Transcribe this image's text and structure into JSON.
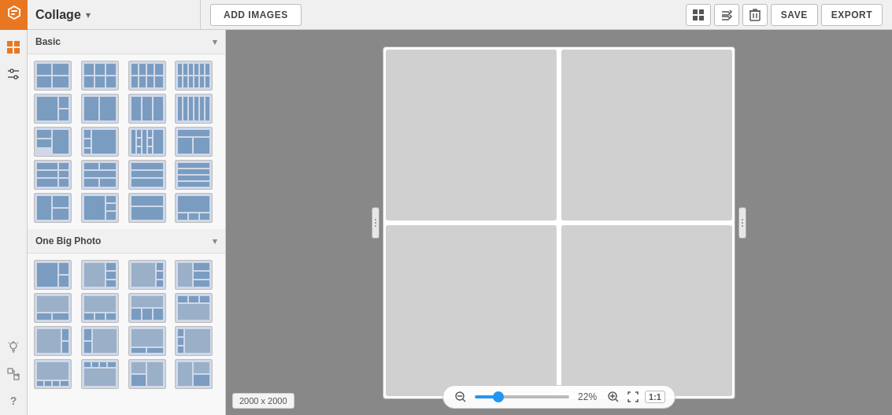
{
  "app": {
    "title": "Collage",
    "logo_symbol": "⬡"
  },
  "topbar": {
    "add_images_label": "ADD IMAGES",
    "save_label": "SAVE",
    "export_label": "EXPORT"
  },
  "toolbar": {
    "grid_icon": "⊞",
    "shuffle_icon": "⇌",
    "delete_icon": "🗑"
  },
  "panel": {
    "sections": [
      {
        "id": "basic",
        "label": "Basic",
        "expanded": true
      },
      {
        "id": "one-big-photo",
        "label": "One Big Photo",
        "expanded": true
      }
    ]
  },
  "canvas": {
    "size_label": "2000 x 2000",
    "zoom_percent": "22%",
    "ratio_label": "1:1"
  },
  "sidebar_icons": [
    {
      "id": "grid",
      "symbol": "▦",
      "active": true
    },
    {
      "id": "sliders",
      "symbol": "⊟",
      "active": false
    }
  ],
  "sidebar_bottom_icons": [
    {
      "id": "bulb",
      "symbol": "💡",
      "active": false
    },
    {
      "id": "transform",
      "symbol": "⤢",
      "active": false
    },
    {
      "id": "help",
      "symbol": "?",
      "active": false
    }
  ]
}
